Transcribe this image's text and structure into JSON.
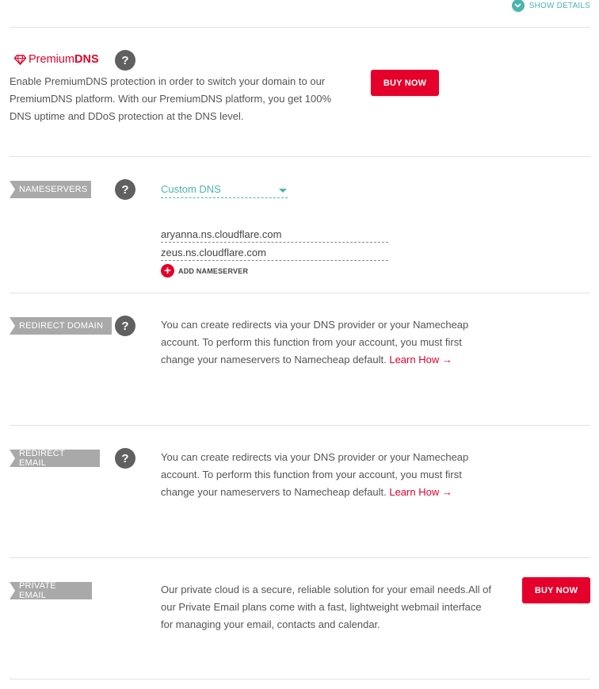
{
  "header": {
    "show_details_label": "SHOW DETAILS",
    "show_details_icon": "chevron-down-icon"
  },
  "premium_dns": {
    "logo_prefix": "Premium",
    "logo_suffix": "DNS",
    "logo_icon": "diamond-icon",
    "help": "?",
    "description": "Enable PremiumDNS protection in order to switch your domain to our PremiumDNS platform. With our PremiumDNS platform, you get 100% DNS uptime and DDoS protection at the DNS level.",
    "buy_label": "BUY NOW"
  },
  "nameservers": {
    "tag": "NAMESERVERS",
    "help": "?",
    "selected_option": "Custom DNS",
    "entries": [
      "aryanna.ns.cloudflare.com",
      "zeus.ns.cloudflare.com"
    ],
    "add_label": "ADD NAMESERVER",
    "add_icon": "plus-circle-icon"
  },
  "redirect_domain": {
    "tag": "REDIRECT DOMAIN",
    "help": "?",
    "text": "You can create redirects via your DNS provider or your Namecheap account. To perform this function from your account, you must first change your nameservers to Namecheap default.",
    "link": "Learn How →"
  },
  "redirect_email": {
    "tag": "REDIRECT EMAIL",
    "help": "?",
    "text": "You can create redirects via your DNS provider or your Namecheap account. To perform this function from your account, you must first change your nameservers to Namecheap default.",
    "link": "Learn How →"
  },
  "private_email": {
    "tag": "PRIVATE EMAIL",
    "text": "Our private cloud is a secure, reliable solution for your email needs.All of our Private Email plans come with a fast, lightweight webmail interface for managing your email, contacts and calendar.",
    "buy_label": "BUY NOW"
  },
  "colors": {
    "accent_teal": "#4bb5ad",
    "brand_red": "#e4002b",
    "tag_gray": "#a9a9a9",
    "help_gray": "#606060"
  }
}
